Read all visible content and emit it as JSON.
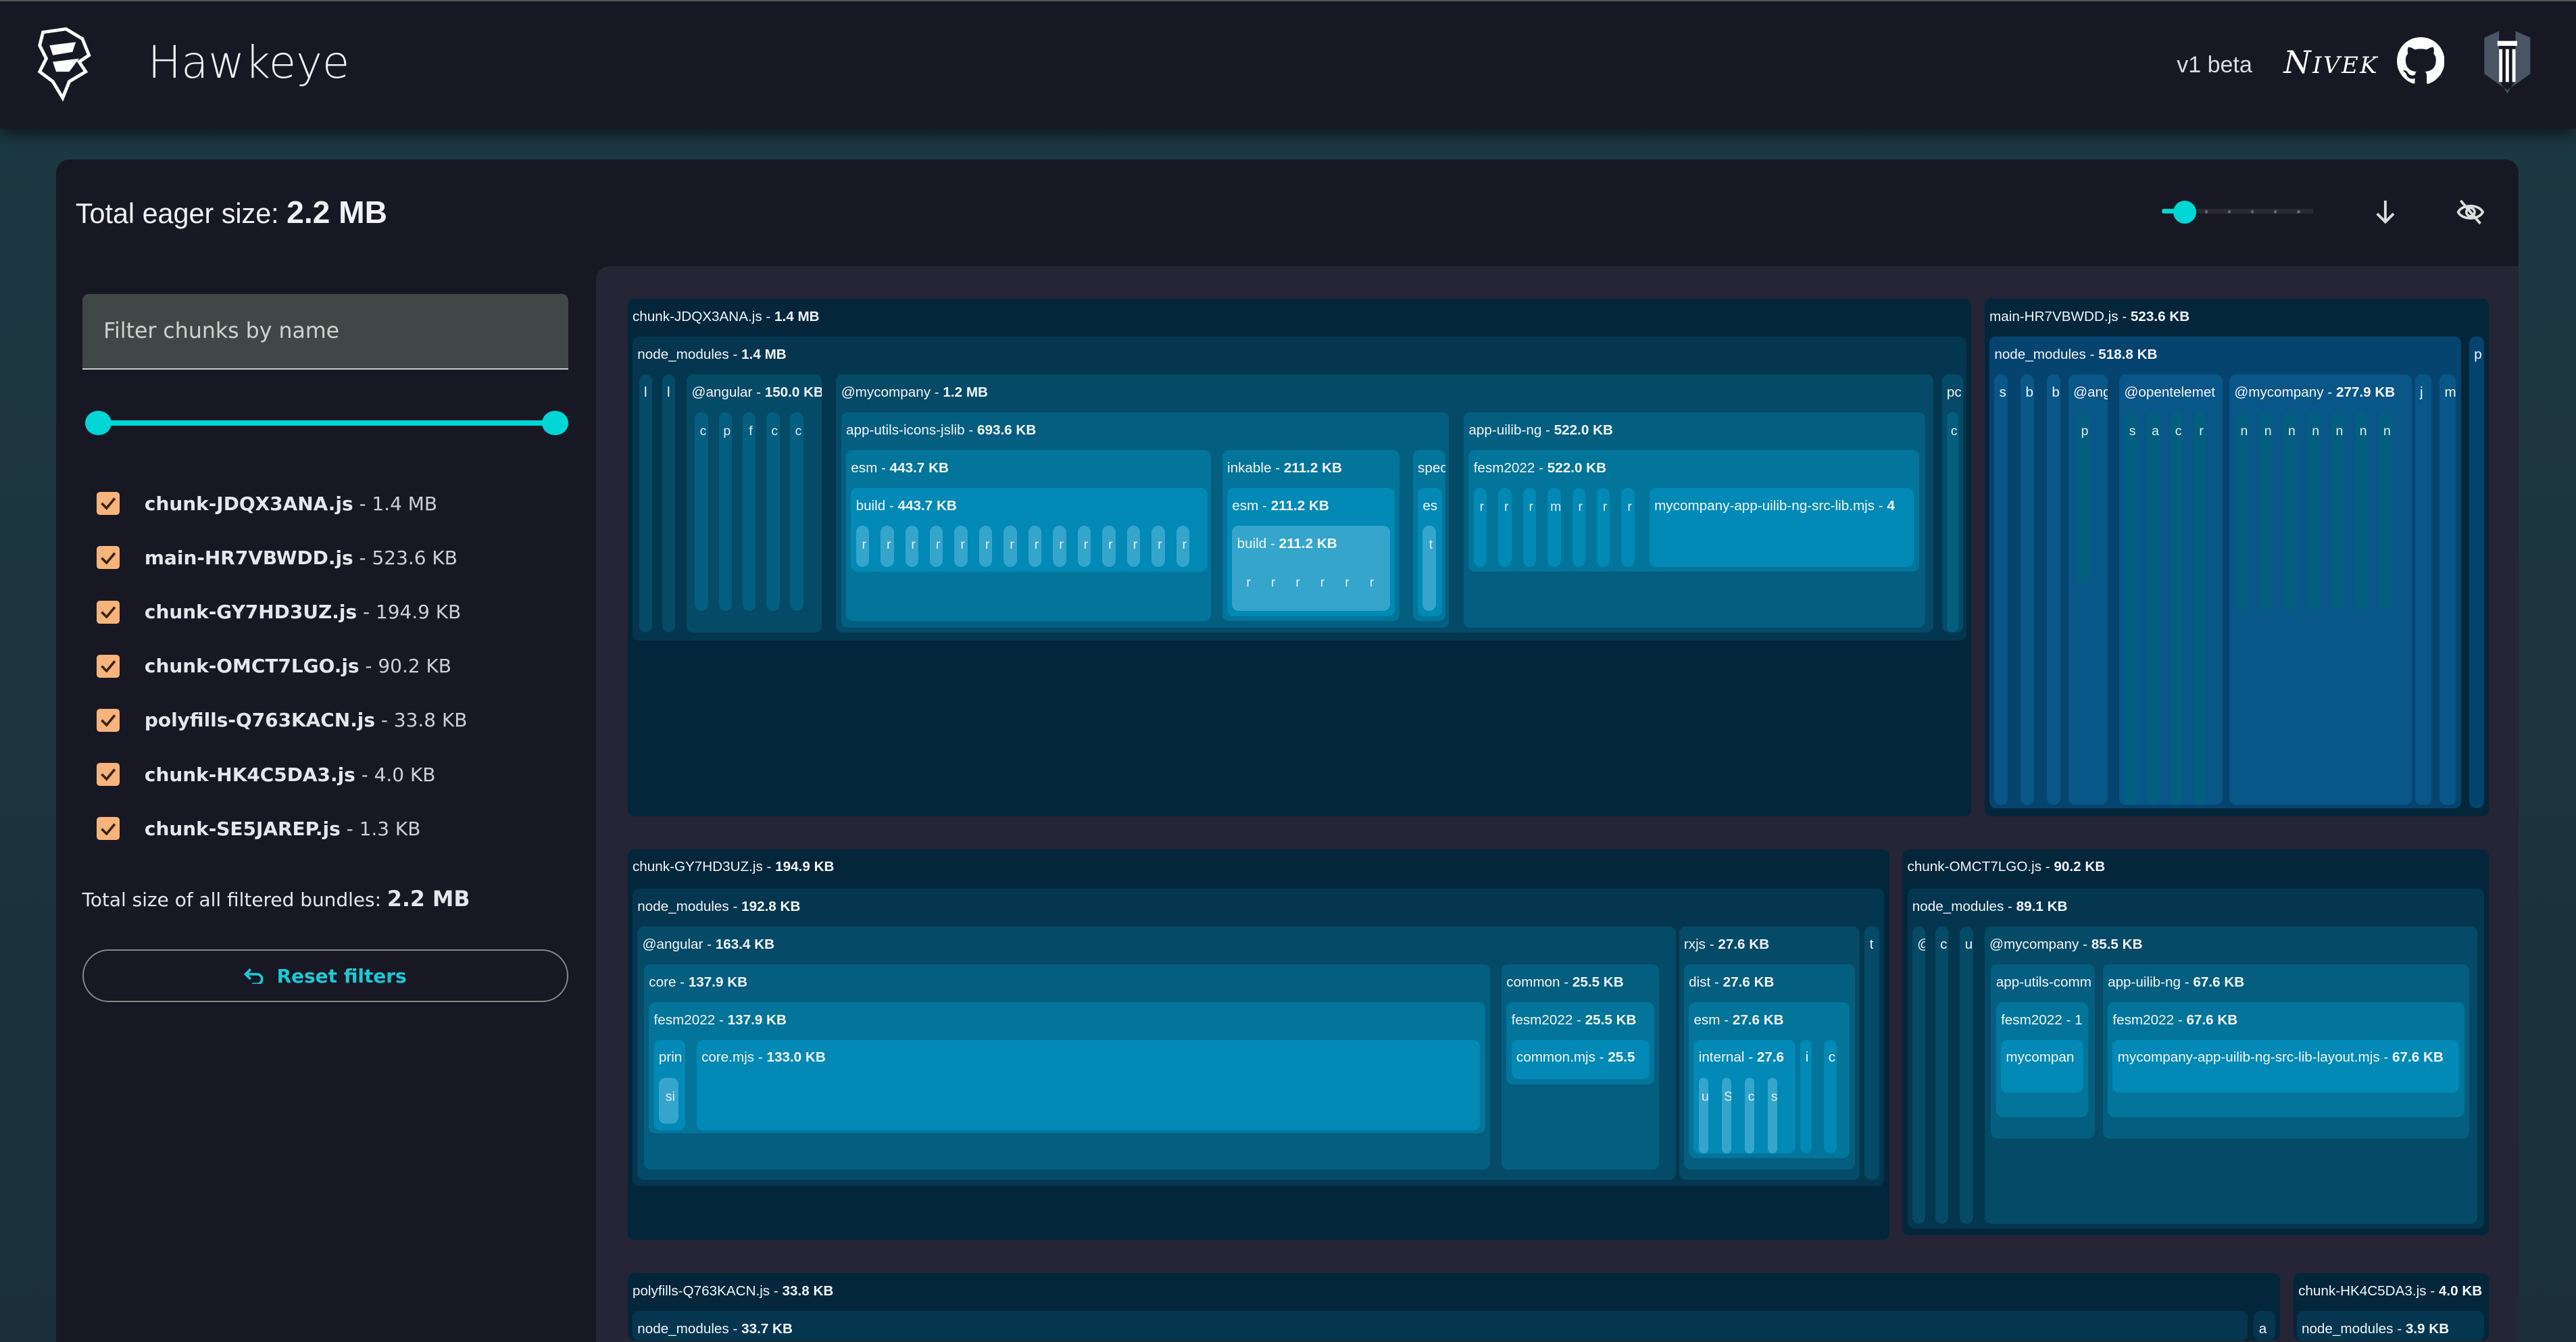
{
  "header": {
    "title": "Hawkeye",
    "version": "v1 beta",
    "signature": "Nivek",
    "icons": [
      "hawk-logo",
      "github-icon",
      "pillar-logo"
    ]
  },
  "toolbar": {
    "eager_label": "Total eager size:",
    "eager_value": "2.2 MB",
    "zoom_level_index": 0,
    "zoom_steps": 6,
    "download_icon": "arrow-down-icon",
    "hide_icon": "eye-off-icon"
  },
  "sidebar": {
    "filter_placeholder": "Filter chunks by name",
    "filter_value": "",
    "size_range_percent": [
      0,
      100
    ],
    "chunks": [
      {
        "name": "chunk-JDQX3ANA.js",
        "size": "1.4 MB",
        "checked": true
      },
      {
        "name": "main-HR7VBWDD.js",
        "size": "523.6 KB",
        "checked": true
      },
      {
        "name": "chunk-GY7HD3UZ.js",
        "size": "194.9 KB",
        "checked": true
      },
      {
        "name": "chunk-OMCT7LGO.js",
        "size": "90.2 KB",
        "checked": true
      },
      {
        "name": "polyfills-Q763KACN.js",
        "size": "33.8 KB",
        "checked": true
      },
      {
        "name": "chunk-HK4C5DA3.js",
        "size": "4.0 KB",
        "checked": true
      },
      {
        "name": "chunk-SE5JAREP.js",
        "size": "1.3 KB",
        "checked": true
      }
    ],
    "total_label": "Total size of all filtered bundles:",
    "total_value": "2.2 MB",
    "reset_label": "Reset filters"
  },
  "colors": {
    "accent": "#00d6d6",
    "checkbox": "#f7b47a",
    "reset_text": "#1cc9d4",
    "levels": [
      "#03263b",
      "#04364f",
      "#054a66",
      "#045e80",
      "#03749a",
      "#0289b5",
      "#35a5cc"
    ]
  },
  "treemap": {
    "nodes": [
      {
        "id": "c1",
        "parent": null,
        "name": "chunk-JDQX3ANA.js",
        "size": "1.4 MB"
      },
      {
        "id": "c1nm",
        "parent": "c1",
        "name": "node_modules",
        "size": "1.4 MB"
      },
      {
        "id": "c1l1",
        "parent": "c1nm",
        "name": "l"
      },
      {
        "id": "c1l2",
        "parent": "c1nm",
        "name": "l"
      },
      {
        "id": "c1ang",
        "parent": "c1nm",
        "name": "@angular",
        "size": "150.0 KB",
        "bars": [
          "c",
          "p",
          "f",
          "c",
          "c"
        ]
      },
      {
        "id": "c1my",
        "parent": "c1nm",
        "name": "@mycompany",
        "size": "1.2 MB"
      },
      {
        "id": "c1icons",
        "parent": "c1my",
        "name": "app-utils-icons-jslib",
        "size": "693.6 KB"
      },
      {
        "id": "c1esm",
        "parent": "c1icons",
        "name": "esm",
        "size": "443.7 KB"
      },
      {
        "id": "c1build",
        "parent": "c1esm",
        "name": "build",
        "size": "443.7 KB",
        "bars": [
          "r",
          "r",
          "r",
          "r",
          "r",
          "r",
          "r",
          "r",
          "r",
          "r",
          "r",
          "r",
          "r",
          "r"
        ]
      },
      {
        "id": "c1ink",
        "parent": "c1icons",
        "name": "inkable",
        "size": "211.2 KB"
      },
      {
        "id": "c1inkesm",
        "parent": "c1ink",
        "name": "esm",
        "size": "211.2 KB"
      },
      {
        "id": "c1inkbuild",
        "parent": "c1inkesm",
        "name": "build",
        "size": "211.2 KB",
        "bars": [
          "r",
          "r",
          "r",
          "r",
          "r",
          "r"
        ]
      },
      {
        "id": "c1spec",
        "parent": "c1icons",
        "name": "spec"
      },
      {
        "id": "c1speces",
        "parent": "c1spec",
        "name": "es",
        "bars": [
          "t"
        ]
      },
      {
        "id": "c1uilib",
        "parent": "c1my",
        "name": "app-uilib-ng",
        "size": "522.0 KB"
      },
      {
        "id": "c1fesm",
        "parent": "c1uilib",
        "name": "fesm2022",
        "size": "522.0 KB",
        "bars": [
          "r",
          "r",
          "r",
          "m",
          "r",
          "r",
          "r"
        ]
      },
      {
        "id": "c1libmjs",
        "parent": "c1fesm",
        "name": "mycompany-app-uilib-ng-src-lib.mjs",
        "size": "4"
      },
      {
        "id": "c1pc",
        "parent": "c1nm",
        "name": "pc",
        "bars": [
          "c"
        ]
      },
      {
        "id": "c2",
        "parent": null,
        "name": "main-HR7VBWDD.js",
        "size": "523.6 KB"
      },
      {
        "id": "c2nm",
        "parent": "c2",
        "name": "node_modules",
        "size": "518.8 KB"
      },
      {
        "id": "c2s",
        "parent": "c2nm",
        "name": "s"
      },
      {
        "id": "c2b1",
        "parent": "c2nm",
        "name": "b"
      },
      {
        "id": "c2b2",
        "parent": "c2nm",
        "name": "b"
      },
      {
        "id": "c2ang",
        "parent": "c2nm",
        "name": "@ang",
        "bars": [
          "p"
        ]
      },
      {
        "id": "c2otel",
        "parent": "c2nm",
        "name": "@opentelemet",
        "bars": [
          "s",
          "a",
          "c",
          "r"
        ]
      },
      {
        "id": "c2my",
        "parent": "c2nm",
        "name": "@mycompany",
        "size": "277.9 KB",
        "bars": [
          "n",
          "n",
          "n",
          "n",
          "n",
          "n",
          "n"
        ]
      },
      {
        "id": "c2j",
        "parent": "c2nm",
        "name": "j"
      },
      {
        "id": "c2m",
        "parent": "c2nm",
        "name": "m"
      },
      {
        "id": "c2p",
        "parent": "c2",
        "name": "p"
      },
      {
        "id": "c3",
        "parent": null,
        "name": "chunk-GY7HD3UZ.js",
        "size": "194.9 KB"
      },
      {
        "id": "c3nm",
        "parent": "c3",
        "name": "node_modules",
        "size": "192.8 KB"
      },
      {
        "id": "c3ang",
        "parent": "c3nm",
        "name": "@angular",
        "size": "163.4 KB"
      },
      {
        "id": "c3core",
        "parent": "c3ang",
        "name": "core",
        "size": "137.9 KB"
      },
      {
        "id": "c3fesm",
        "parent": "c3core",
        "name": "fesm2022",
        "size": "137.9 KB"
      },
      {
        "id": "c3prin",
        "parent": "c3fesm",
        "name": "prin",
        "bars": [
          "si"
        ]
      },
      {
        "id": "c3coremjs",
        "parent": "c3fesm",
        "name": "core.mjs",
        "size": "133.0 KB"
      },
      {
        "id": "c3common",
        "parent": "c3ang",
        "name": "common",
        "size": "25.5 KB"
      },
      {
        "id": "c3cfesm",
        "parent": "c3common",
        "name": "fesm2022",
        "size": "25.5 KB"
      },
      {
        "id": "c3cmjs",
        "parent": "c3cfesm",
        "name": "common.mjs",
        "size": "25.5"
      },
      {
        "id": "c3rxjs",
        "parent": "c3nm",
        "name": "rxjs",
        "size": "27.6 KB"
      },
      {
        "id": "c3dist",
        "parent": "c3rxjs",
        "name": "dist",
        "size": "27.6 KB"
      },
      {
        "id": "c3esm",
        "parent": "c3dist",
        "name": "esm",
        "size": "27.6 KB"
      },
      {
        "id": "c3internal",
        "parent": "c3esm",
        "name": "internal",
        "size": "27.6",
        "bars": [
          "u",
          "S",
          "c",
          "s"
        ]
      },
      {
        "id": "c3i",
        "parent": "c3esm",
        "name": "i"
      },
      {
        "id": "c3c",
        "parent": "c3esm",
        "name": "c"
      },
      {
        "id": "c3t",
        "parent": "c3nm",
        "name": "t"
      },
      {
        "id": "c4",
        "parent": null,
        "name": "chunk-OMCT7LGO.js",
        "size": "90.2 KB"
      },
      {
        "id": "c4nm",
        "parent": "c4",
        "name": "node_modules",
        "size": "89.1 KB"
      },
      {
        "id": "c4a",
        "parent": "c4nm",
        "name": "@"
      },
      {
        "id": "c4b",
        "parent": "c4nm",
        "name": "c"
      },
      {
        "id": "c4c",
        "parent": "c4nm",
        "name": "u"
      },
      {
        "id": "c4my",
        "parent": "c4nm",
        "name": "@mycompany",
        "size": "85.5 KB"
      },
      {
        "id": "c4utils",
        "parent": "c4my",
        "name": "app-utils-comm"
      },
      {
        "id": "c4ufesm",
        "parent": "c4utils",
        "name": "fesm2022 - 1"
      },
      {
        "id": "c4umjs",
        "parent": "c4ufesm",
        "name": "mycompan"
      },
      {
        "id": "c4uilib",
        "parent": "c4my",
        "name": "app-uilib-ng",
        "size": "67.6 KB"
      },
      {
        "id": "c4fesm",
        "parent": "c4uilib",
        "name": "fesm2022",
        "size": "67.6 KB"
      },
      {
        "id": "c4layout",
        "parent": "c4fesm",
        "name": "mycompany-app-uilib-ng-src-lib-layout.mjs",
        "size": "67.6 KB"
      },
      {
        "id": "c5",
        "parent": null,
        "name": "polyfills-Q763KACN.js",
        "size": "33.8 KB"
      },
      {
        "id": "c5nm",
        "parent": "c5",
        "name": "node_modules",
        "size": "33.7 KB"
      },
      {
        "id": "c5a",
        "parent": "c5",
        "name": "a"
      },
      {
        "id": "c6",
        "parent": null,
        "name": "chunk-HK4C5DA3.js",
        "size": "4.0 KB"
      },
      {
        "id": "c6nm",
        "parent": "c6",
        "name": "node_modules",
        "size": "3.9 KB"
      }
    ]
  }
}
